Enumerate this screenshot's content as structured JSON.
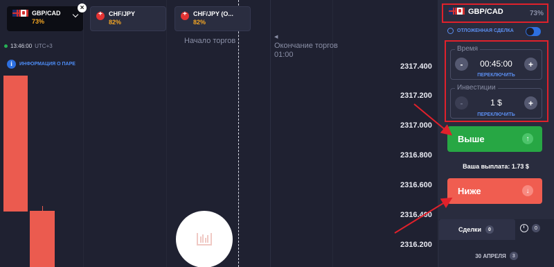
{
  "tabs": [
    {
      "name": "GBP/CAD",
      "percent": "73%"
    },
    {
      "name": "CHF/JPY",
      "percent": "82%"
    },
    {
      "name": "CHF/JPY (O...",
      "percent": "82%"
    }
  ],
  "chart": {
    "time": "13:46:00",
    "timezone": "UTC+3",
    "info_label": "ИНФОРМАЦИЯ О ПАРЕ",
    "start_label": "Начало торгов",
    "end_label": "Окончание торгов",
    "end_time": "01:00",
    "prices": [
      "2317.400",
      "2317.200",
      "2317.000",
      "2316.800",
      "2316.600",
      "2316.400",
      "2316.200"
    ]
  },
  "panel": {
    "pair": "GBP/CAD",
    "pair_percent": "73%",
    "pending_label": "ОТЛОЖЕННАЯ СДЕЛКА",
    "time_label": "Время",
    "time_value": "00:45:00",
    "switch_label": "ПЕРЕКЛЮЧИТЬ",
    "invest_label": "Инвестиции",
    "invest_value": "1 $",
    "minus": "-",
    "plus": "+",
    "up_label": "Выше",
    "up_icon": "↑",
    "payout": "Ваша выплата: 1.73 $",
    "down_label": "Ниже",
    "down_icon": "↓",
    "deals_label": "Сделки",
    "deals_count": "0",
    "history_count": "0",
    "date_label": "30 АПРЕЛЯ",
    "date_count": "3"
  },
  "colors": {
    "up": "#27a744",
    "down": "#f05d50",
    "highlight": "#e0212b",
    "accent": "#f5a623"
  },
  "icons": [
    "close-icon",
    "chevron-down-icon",
    "info-icon",
    "clock-icon",
    "arrow-up-icon",
    "arrow-down-icon",
    "history-icon"
  ]
}
